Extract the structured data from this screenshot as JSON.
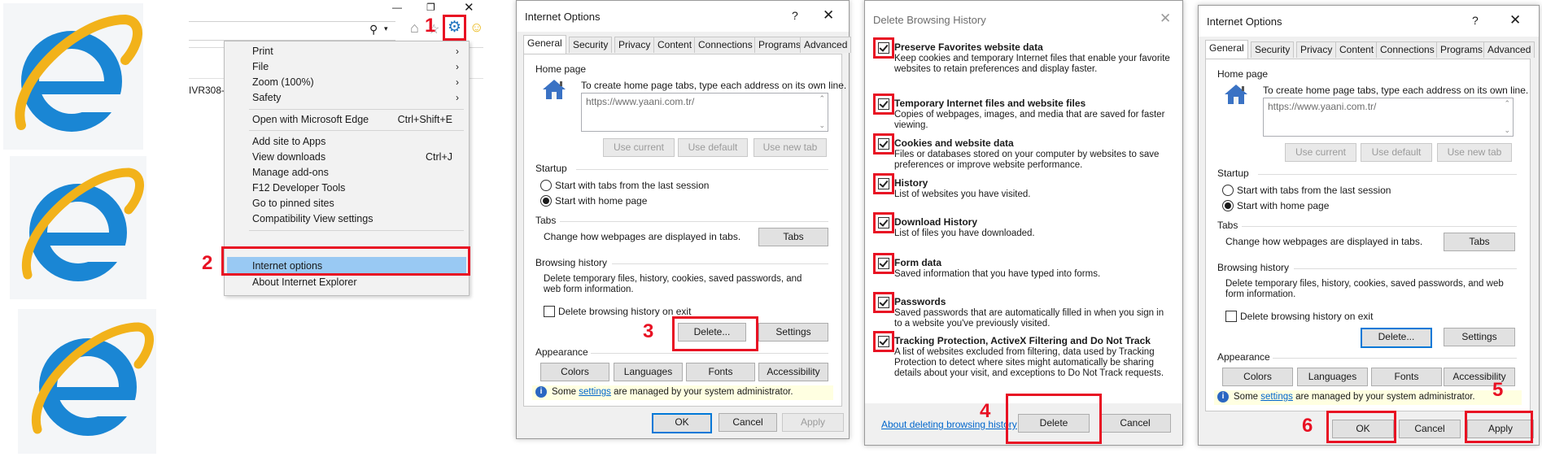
{
  "menu": {
    "items": [
      {
        "label": "Print",
        "submenu": true
      },
      {
        "label": "File",
        "submenu": true
      },
      {
        "label": "Zoom (100%)",
        "submenu": true
      },
      {
        "label": "Safety",
        "submenu": true
      },
      {
        "label": "Open with Microsoft Edge",
        "shortcut": "Ctrl+Shift+E"
      },
      {
        "label": "Add site to Apps"
      },
      {
        "label": "View downloads",
        "shortcut": "Ctrl+J"
      },
      {
        "label": "Manage add-ons"
      },
      {
        "label": "F12 Developer Tools"
      },
      {
        "label": "Go to pinned sites"
      },
      {
        "label": "Compatibility View settings"
      },
      {
        "label": "Internet options"
      },
      {
        "label": "About Internet Explorer"
      }
    ],
    "tab_fragment": "IVR308-3"
  },
  "steps": [
    "1",
    "2",
    "3",
    "4",
    "5",
    "6"
  ],
  "internet_options": {
    "title": "Internet Options",
    "help": "?",
    "close": "✕",
    "tabs": [
      "General",
      "Security",
      "Privacy",
      "Content",
      "Connections",
      "Programs",
      "Advanced"
    ],
    "home_page": {
      "heading": "Home page",
      "hint": "To create home page tabs, type each address on its own line.",
      "url": "https://www.yaani.com.tr/",
      "use_current": "Use current",
      "use_default": "Use default",
      "use_new_tab": "Use new tab"
    },
    "startup": {
      "heading": "Startup",
      "option_tabs": "Start with tabs from the last session",
      "option_home": "Start with home page"
    },
    "tabs_group": {
      "heading": "Tabs",
      "desc": "Change how webpages are displayed in tabs.",
      "button": "Tabs"
    },
    "browsing_history": {
      "heading": "Browsing history",
      "desc": "Delete temporary files, history, cookies, saved passwords, and web form information.",
      "delete_on_exit": "Delete browsing history on exit",
      "delete_button": "Delete...",
      "settings_button": "Settings"
    },
    "appearance": {
      "heading": "Appearance",
      "colors": "Colors",
      "languages": "Languages",
      "fonts": "Fonts",
      "accessibility": "Accessibility"
    },
    "info": {
      "pre": "Some ",
      "link": "settings",
      "post": " are managed by your system administrator."
    },
    "ok": "OK",
    "cancel": "Cancel",
    "apply": "Apply"
  },
  "delete_history": {
    "title": "Delete Browsing History",
    "close": "✕",
    "items": [
      {
        "title": "Preserve Favorites website data",
        "desc": "Keep cookies and temporary Internet files that enable your favorite websites to retain preferences and display faster.",
        "checked": true
      },
      {
        "title": "Temporary Internet files and website files",
        "desc": "Copies of webpages, images, and media that are saved for faster viewing.",
        "checked": true
      },
      {
        "title": "Cookies and website data",
        "desc": "Files or databases stored on your computer by websites to save preferences or improve website performance.",
        "checked": true
      },
      {
        "title": "History",
        "desc": "List of websites you have visited.",
        "checked": true
      },
      {
        "title": "Download History",
        "desc": "List of files you have downloaded.",
        "checked": true
      },
      {
        "title": "Form data",
        "desc": "Saved information that you have typed into forms.",
        "checked": true
      },
      {
        "title": "Passwords",
        "desc": "Saved passwords that are automatically filled in when you sign in to a website you've previously visited.",
        "checked": true
      },
      {
        "title": "Tracking Protection, ActiveX Filtering and Do Not Track",
        "desc": "A list of websites excluded from filtering, data used by Tracking Protection to detect where sites might automatically be sharing details about your visit, and exceptions to Do Not Track requests.",
        "checked": true
      }
    ],
    "about_link": "About deleting browsing history",
    "delete": "Delete",
    "cancel": "Cancel"
  }
}
